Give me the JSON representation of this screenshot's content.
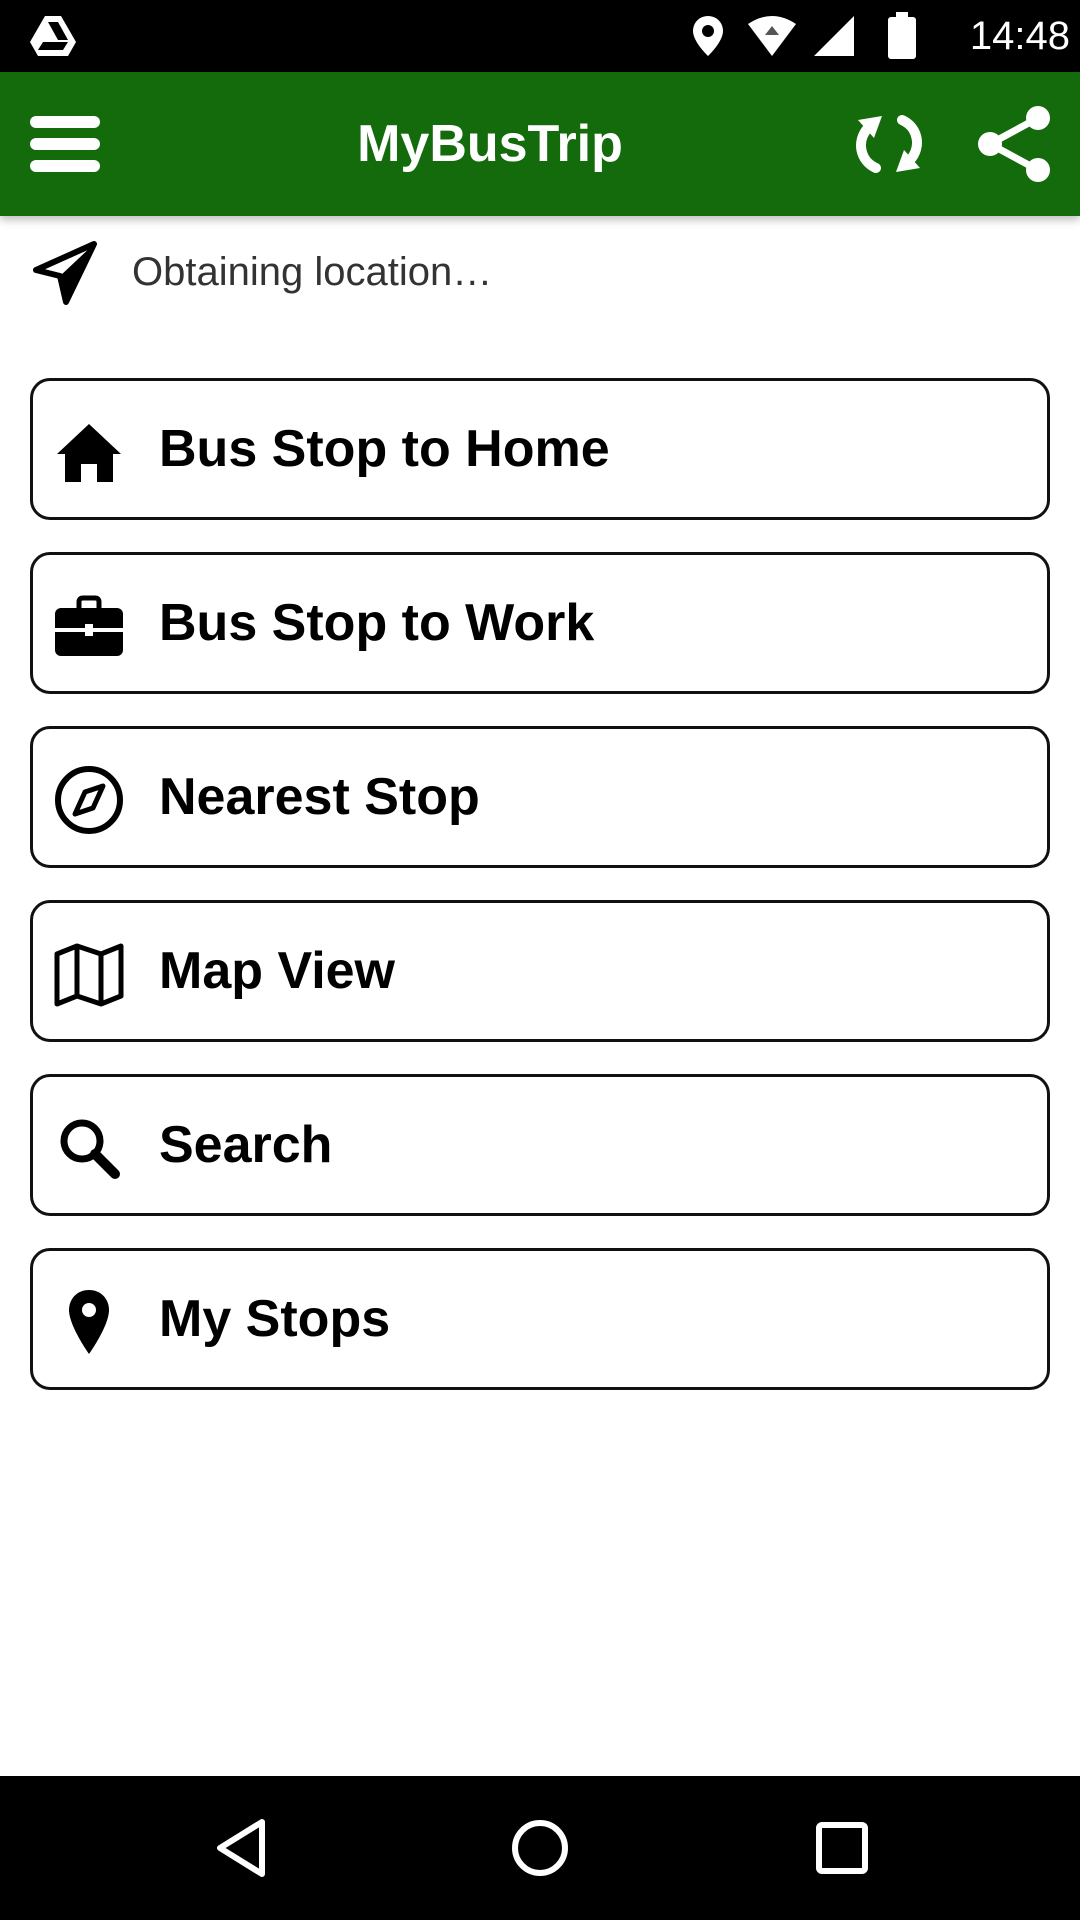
{
  "status_bar": {
    "time": "14:48",
    "icons": [
      "drive-icon",
      "location-icon",
      "wifi-icon",
      "signal-icon",
      "battery-icon"
    ]
  },
  "app_bar": {
    "title": "MyBusTrip",
    "color": "#146b0c",
    "icons": [
      "menu-icon",
      "refresh-icon",
      "share-icon"
    ]
  },
  "location": {
    "text": "Obtaining location…",
    "icon": "navigation-arrow-icon"
  },
  "menu": [
    {
      "label": "Bus Stop to Home",
      "icon": "home-icon"
    },
    {
      "label": "Bus Stop to Work",
      "icon": "briefcase-icon"
    },
    {
      "label": "Nearest Stop",
      "icon": "compass-icon"
    },
    {
      "label": "Map View",
      "icon": "map-icon"
    },
    {
      "label": "Search",
      "icon": "search-icon"
    },
    {
      "label": "My Stops",
      "icon": "map-pin-icon"
    }
  ],
  "nav_bar": {
    "icons": [
      "back-icon",
      "home-circle-icon",
      "recents-icon"
    ]
  }
}
